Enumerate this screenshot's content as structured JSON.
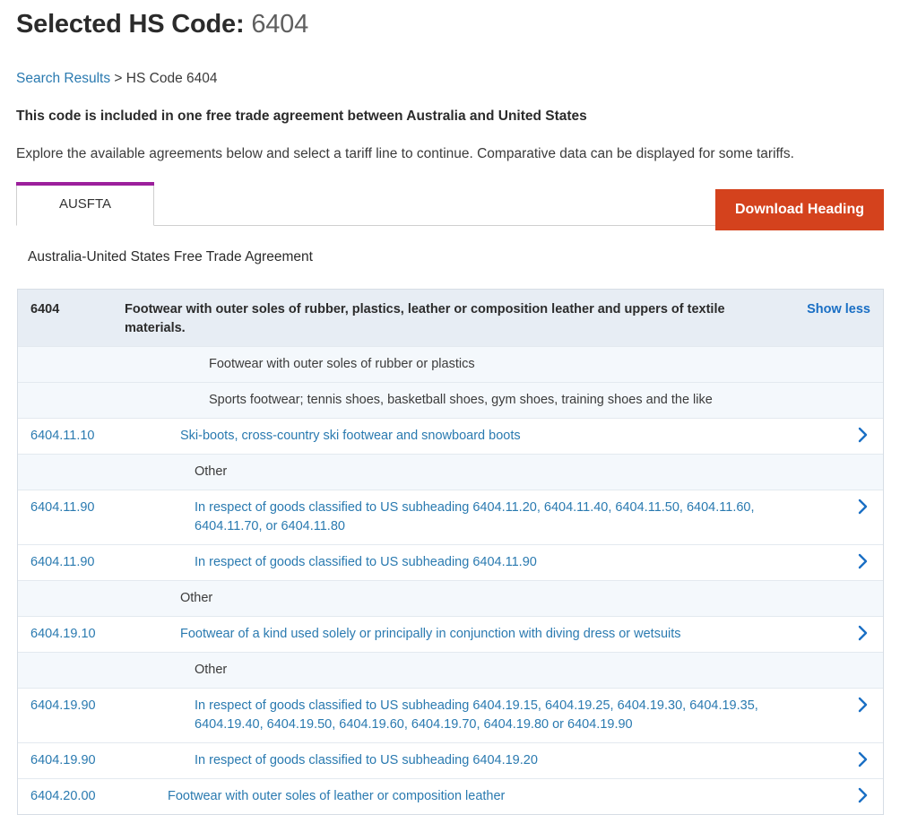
{
  "header": {
    "title_label": "Selected HS Code:",
    "code": "6404"
  },
  "breadcrumb": {
    "link_label": "Search Results",
    "separator": ">",
    "current": "HS Code 6404"
  },
  "notes": {
    "included": "This code is included in one free trade agreement between Australia and United States",
    "explore": "Explore the available agreements below and select a tariff line to continue. Comparative data can be displayed for some tariffs."
  },
  "tabs": [
    {
      "label": "AUSFTA",
      "active": true
    }
  ],
  "toolbar": {
    "download_label": "Download Heading"
  },
  "agreement": {
    "name": "Australia-United States Free Trade Agreement"
  },
  "table": {
    "show_less_label": "Show less",
    "chevron_icon": "chevron-right-icon",
    "rows": [
      {
        "type": "heading",
        "code": "6404",
        "description": "Footwear with outer soles of rubber, plastics, leather or composition leather and uppers of textile materials.",
        "indent": 0,
        "action": "show-less"
      },
      {
        "type": "group",
        "code": "",
        "description": "Footwear with outer soles of rubber or plastics",
        "indent": 5,
        "action": "none"
      },
      {
        "type": "group",
        "code": "",
        "description": "Sports footwear; tennis shoes, basketball shoes, gym shoes, training shoes and the like",
        "indent": 5,
        "action": "none"
      },
      {
        "type": "line",
        "code": "6404.11.10",
        "description": "Ski-boots, cross-country ski footwear and snowboard boots",
        "indent": 3,
        "action": "chevron"
      },
      {
        "type": "group",
        "code": "",
        "description": "Other",
        "indent": 4,
        "action": "none"
      },
      {
        "type": "line",
        "code": "6404.11.90",
        "description": "In respect of goods classified to US subheading 6404.11.20, 6404.11.40, 6404.11.50, 6404.11.60, 6404.11.70, or 6404.11.80",
        "indent": 4,
        "action": "chevron"
      },
      {
        "type": "line",
        "code": "6404.11.90",
        "description": "In respect of goods classified to US subheading 6404.11.90",
        "indent": 4,
        "action": "chevron"
      },
      {
        "type": "group",
        "code": "",
        "description": "Other",
        "indent": 3,
        "action": "none"
      },
      {
        "type": "line",
        "code": "6404.19.10",
        "description": "Footwear of a kind used solely or principally in conjunction with diving dress or wetsuits",
        "indent": 3,
        "action": "chevron"
      },
      {
        "type": "group",
        "code": "",
        "description": "Other",
        "indent": 4,
        "action": "none"
      },
      {
        "type": "line",
        "code": "6404.19.90",
        "description": "In respect of goods classified to US subheading 6404.19.15, 6404.19.25, 6404.19.30, 6404.19.35, 6404.19.40, 6404.19.50, 6404.19.60, 6404.19.70, 6404.19.80 or 6404.19.90",
        "indent": 4,
        "action": "chevron"
      },
      {
        "type": "line",
        "code": "6404.19.90",
        "description": "In respect of goods classified to US subheading 6404.19.20",
        "indent": 4,
        "action": "chevron"
      },
      {
        "type": "line",
        "code": "6404.20.00",
        "description": "Footwear with outer soles of leather or composition leather",
        "indent": 2,
        "action": "chevron"
      }
    ]
  },
  "colors": {
    "link": "#2a7ab0",
    "accent_purple": "#9c1f9c",
    "download_orange": "#d4421d",
    "heading_row_bg": "#e7edf4",
    "group_row_bg": "#f4f8fc",
    "show_less_blue": "#1a6fc4"
  }
}
